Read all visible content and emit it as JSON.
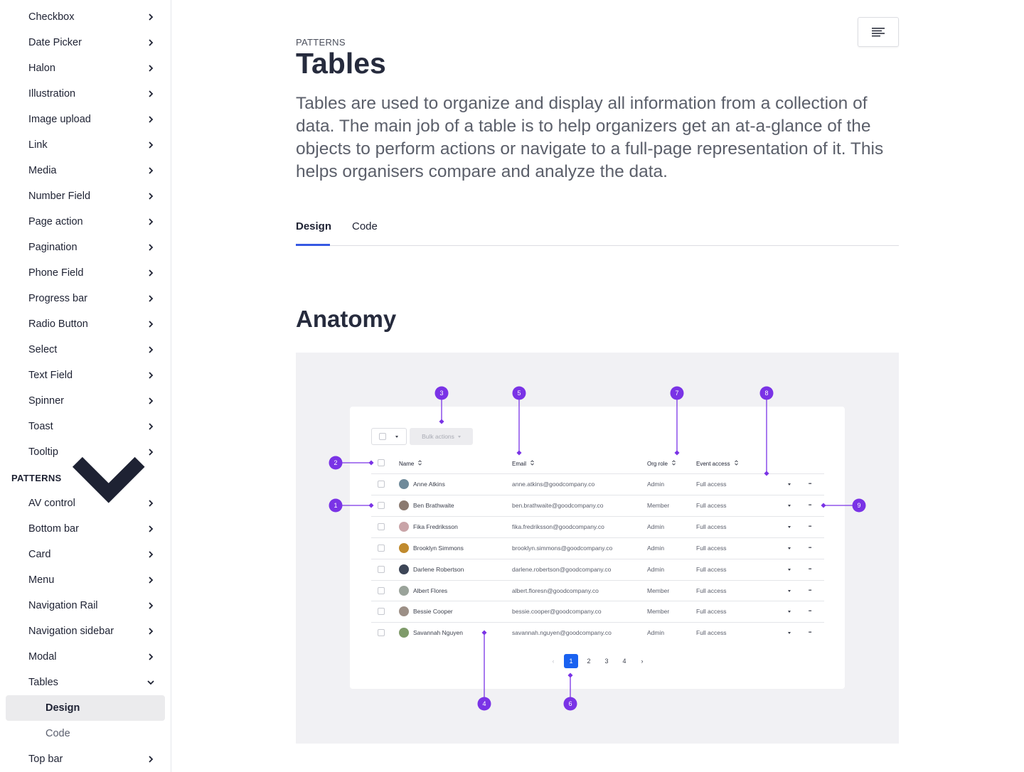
{
  "sidebar": {
    "items_top": [
      "Checkbox",
      "Date Picker",
      "Halon",
      "Illustration",
      "Image upload",
      "Link",
      "Media",
      "Number Field",
      "Page action",
      "Pagination",
      "Phone Field",
      "Progress bar",
      "Radio Button",
      "Select",
      "Text Field",
      "Spinner",
      "Toast",
      "Tooltip"
    ],
    "section": "PATTERNS",
    "items_patterns": [
      "AV control",
      "Bottom bar",
      "Card",
      "Menu",
      "Navigation Rail",
      "Navigation sidebar",
      "Modal",
      "Tables"
    ],
    "tables_sub": [
      "Design",
      "Code"
    ],
    "items_bottom": [
      "Top bar"
    ]
  },
  "page": {
    "eyebrow": "PATTERNS",
    "title": "Tables",
    "lead": "Tables are used to organize and display all information from a collection of data. The main job of a table is to help organizers get an at-a-glance of the objects to perform actions or navigate to a full-page representation of it. This helps organisers compare and analyze the data.",
    "tabs": [
      "Design",
      "Code"
    ],
    "active_tab": "Design",
    "section_heading": "Anatomy"
  },
  "anatomy": {
    "bulk_actions": "Bulk actions",
    "columns": [
      "Name",
      "Email",
      "Org role",
      "Event access"
    ],
    "rows": [
      {
        "name": "Anne Atkins",
        "email": "anne.atkins@goodcompany.co",
        "role": "Admin",
        "access": "Full access",
        "avatar": "#6f8a9a"
      },
      {
        "name": "Ben Brathwaite",
        "email": "ben.brathwaite@goodcompany.co",
        "role": "Member",
        "access": "Full access",
        "avatar": "#8b7a70"
      },
      {
        "name": "Fika Fredriksson",
        "email": "fika.fredriksson@goodcompany.co",
        "role": "Admin",
        "access": "Full access",
        "avatar": "#c9a4a8"
      },
      {
        "name": "Brooklyn Simmons",
        "email": "brooklyn.simmons@goodcompany.co",
        "role": "Admin",
        "access": "Full access",
        "avatar": "#c08a2e"
      },
      {
        "name": "Darlene Robertson",
        "email": "darlene.robertson@goodcompany.co",
        "role": "Admin",
        "access": "Full access",
        "avatar": "#3d4657"
      },
      {
        "name": "Albert Flores",
        "email": "albert.floresn@goodcompany.co",
        "role": "Member",
        "access": "Full access",
        "avatar": "#9aa39a"
      },
      {
        "name": "Bessie Cooper",
        "email": "bessie.cooper@goodcompany.co",
        "role": "Member",
        "access": "Full access",
        "avatar": "#9c8f86"
      },
      {
        "name": "Savannah Nguyen",
        "email": "savannah.nguyen@goodcompany.co",
        "role": "Admin",
        "access": "Full access",
        "avatar": "#7f9b6a"
      }
    ],
    "pages": [
      "1",
      "2",
      "3",
      "4"
    ],
    "current_page": "1",
    "markers": [
      "1",
      "2",
      "3",
      "4",
      "5",
      "6",
      "7",
      "8",
      "9"
    ],
    "marker_color": "#7a33e6"
  }
}
